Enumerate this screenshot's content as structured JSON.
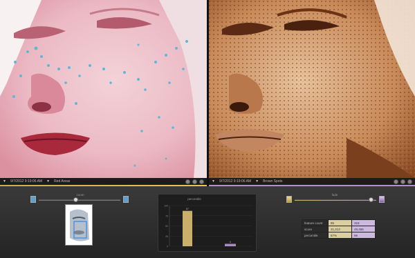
{
  "left_view": {
    "timestamp": "9/7/2012 9:19:06 AM",
    "mode": "Red Areas",
    "accent_color": "#d4b84a"
  },
  "right_view": {
    "timestamp": "9/7/2012 9:19:06 AM",
    "mode": "Brown Spots",
    "accent_color": "#b58fd0"
  },
  "zoom": {
    "title": "zoom",
    "level": 0.45
  },
  "fade": {
    "title": "fade",
    "level": 0.93
  },
  "chart_data": {
    "type": "bar",
    "title": "percentile",
    "categories": [
      "Red Areas",
      "Brown Spots"
    ],
    "values": [
      87,
      6
    ],
    "value_labels": [
      "87",
      "6"
    ],
    "ylim": [
      0,
      100
    ],
    "yticks": [
      0,
      25,
      50,
      75,
      100
    ],
    "colors": [
      "#c9b06a",
      "#a88bc0"
    ]
  },
  "stats": {
    "rows": [
      {
        "label": "feature count",
        "left": "85",
        "right": "318"
      },
      {
        "label": "score",
        "left": "21,213",
        "right": "49,465"
      },
      {
        "label": "percentile",
        "left": "87%",
        "right": "96"
      }
    ]
  }
}
